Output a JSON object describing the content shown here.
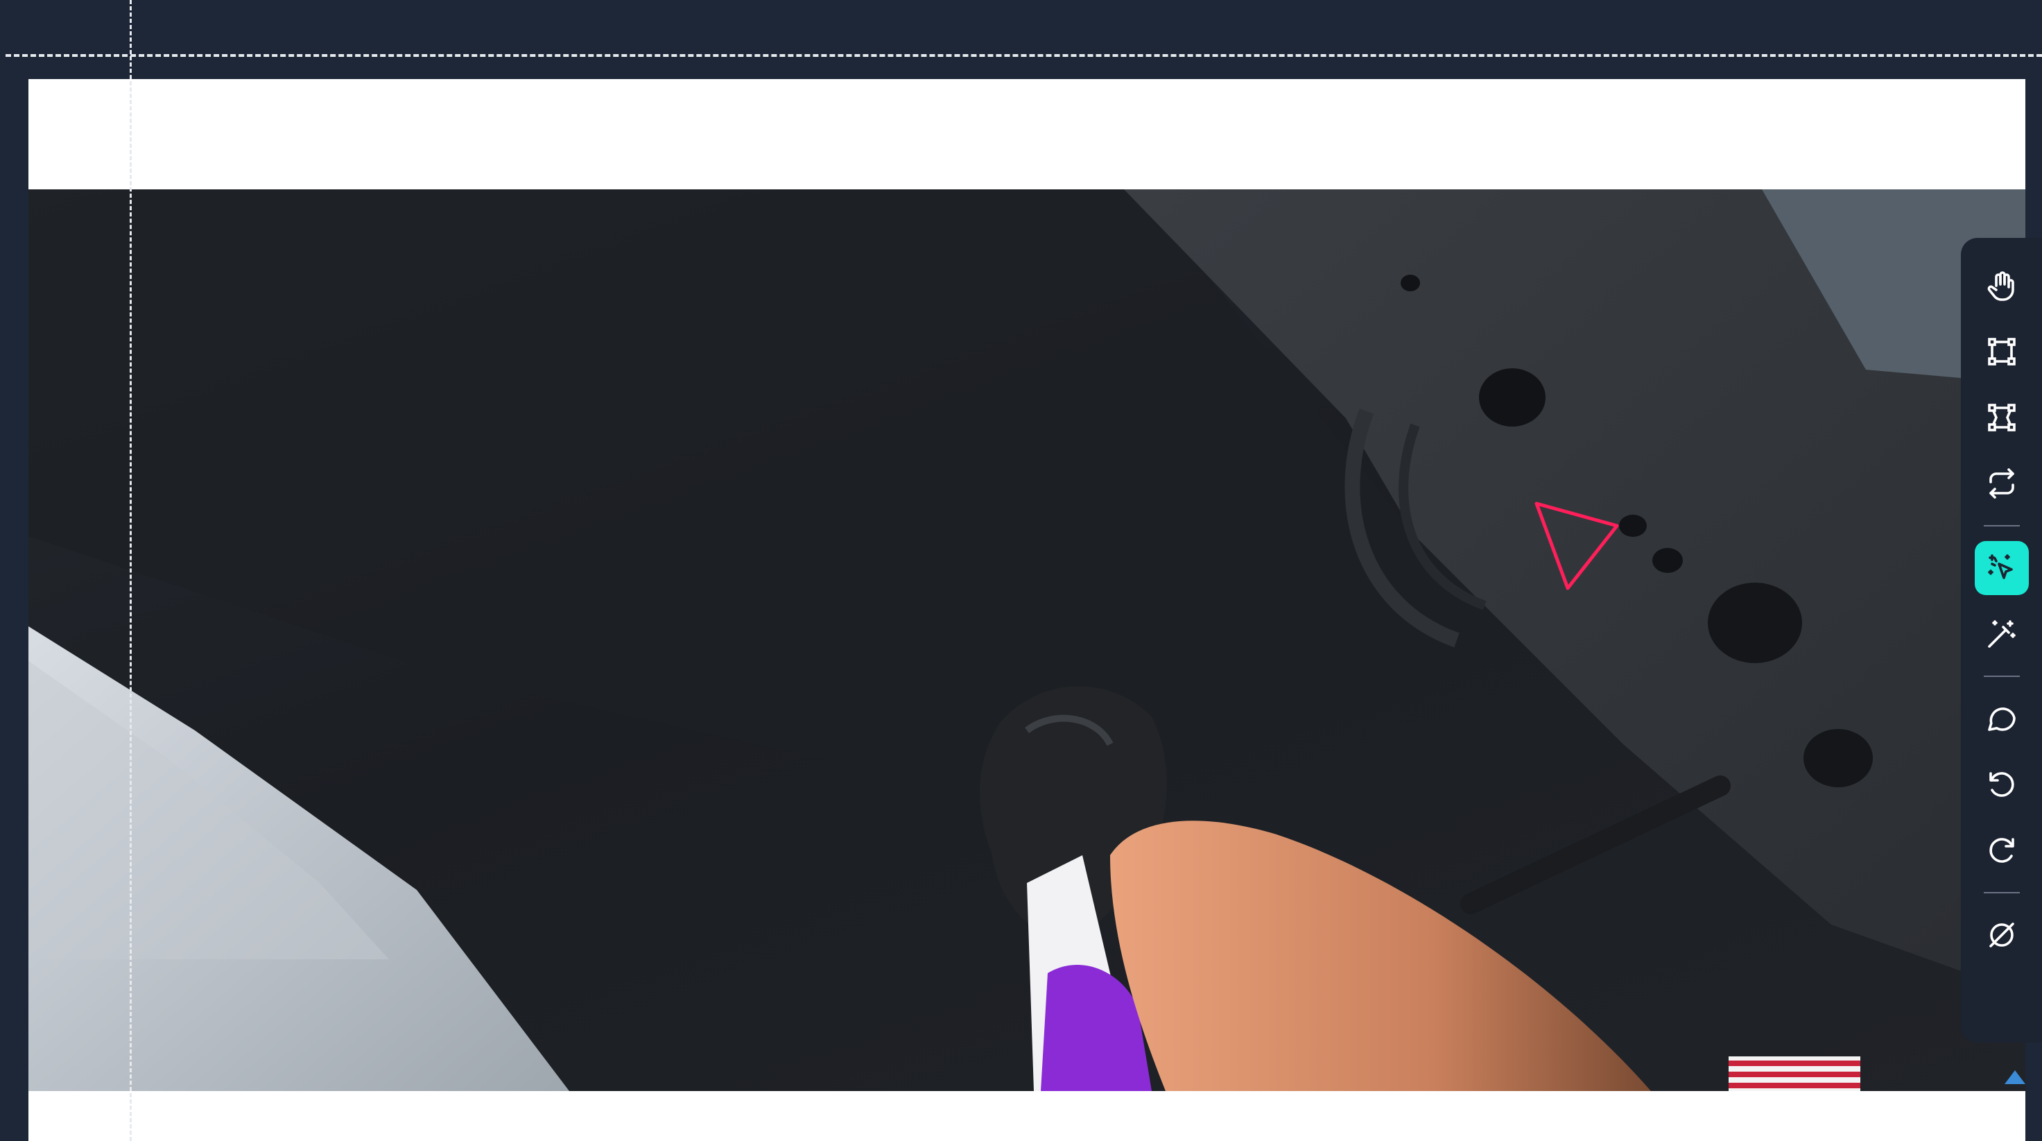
{
  "toolbar": {
    "tools": [
      {
        "name": "pan",
        "icon": "hand-icon"
      },
      {
        "name": "bounding-box",
        "icon": "square-corners-icon"
      },
      {
        "name": "polygon",
        "icon": "polygon-icon"
      },
      {
        "name": "swap",
        "icon": "repeat-arrows-icon"
      },
      {
        "name": "smart-select",
        "icon": "magic-cursor-icon",
        "active": true
      },
      {
        "name": "magic-wand",
        "icon": "magic-wand-icon"
      },
      {
        "name": "comment",
        "icon": "speech-bubble-icon"
      },
      {
        "name": "undo",
        "icon": "undo-icon"
      },
      {
        "name": "redo",
        "icon": "redo-icon"
      },
      {
        "name": "clear",
        "icon": "empty-set-icon"
      }
    ]
  },
  "annotation": {
    "shape": "polygon",
    "color": "#ff1f5a"
  },
  "colors": {
    "background": "#1e2737",
    "toolbar": "#1c2331",
    "active_tool": "#19e6d3"
  }
}
